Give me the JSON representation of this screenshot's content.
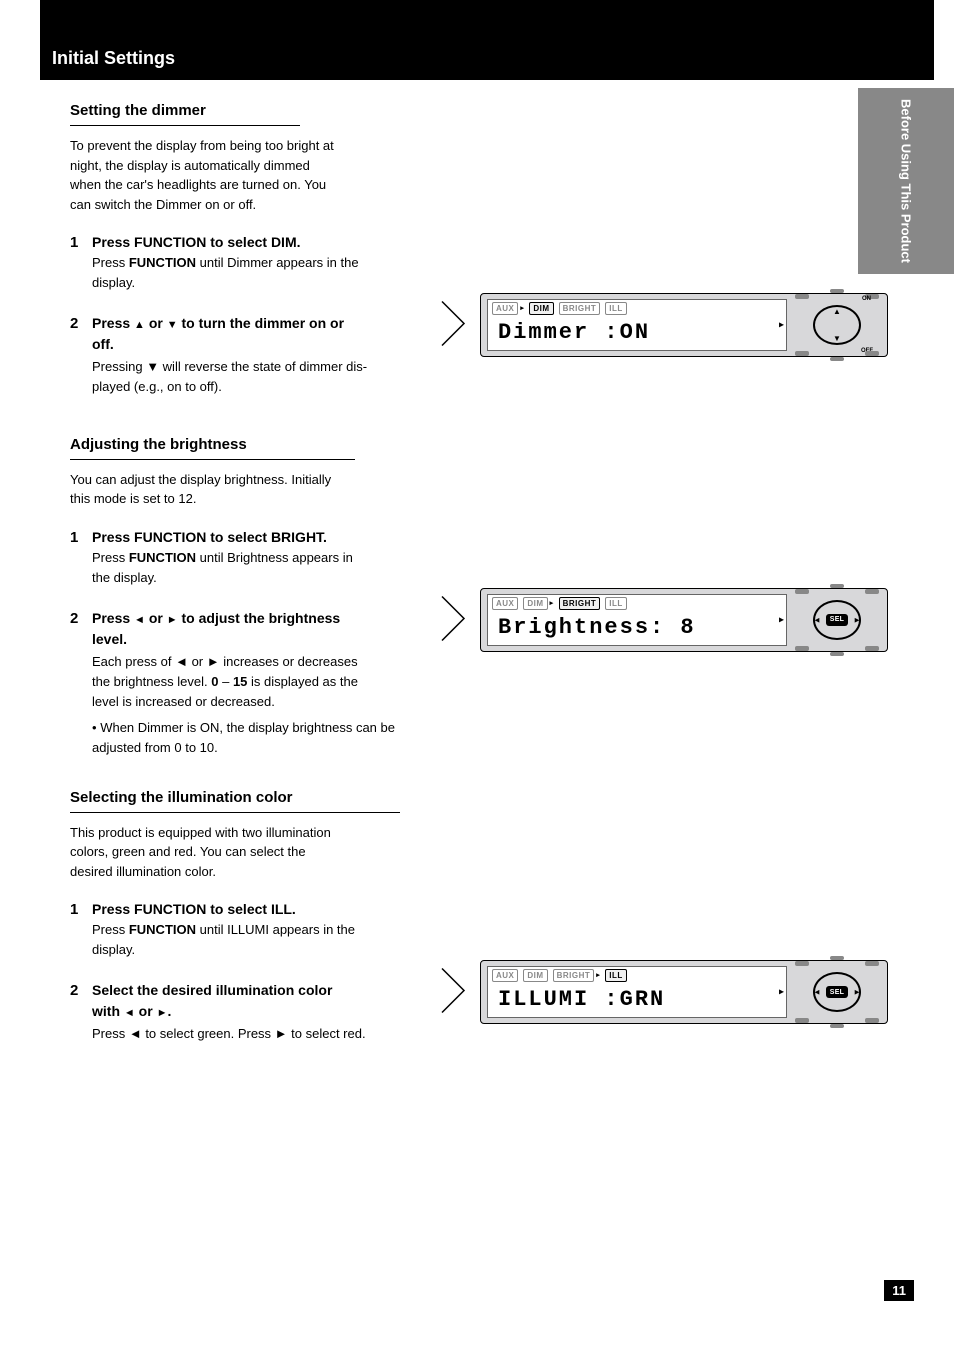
{
  "header_title": "Initial Settings",
  "sidebar_label": "Before Using This Product",
  "sections": {
    "dimmer": {
      "title": "Setting the dimmer",
      "intro_lines": [
        "To prevent the display from being too bright at",
        "night, the display is automatically dimmed",
        "when the car's headlights are turned on. You",
        "can switch the Dimmer on or off."
      ],
      "step1_title": "Press FUNCTION to select DIM.",
      "step1_desc_prefix": "Press ",
      "step1_func": "FUNCTION",
      "step1_desc_mid": " until Dimmer appears in the",
      "step1_desc_end": "display.",
      "step2_prefix": "Press ",
      "step2_arrows_mid": " or ",
      "step2_mid": " to turn the dimmer on or",
      "step2_end": "off.",
      "note_prefix": "Pressing ▼ will reverse the state of dimmer dis-",
      "note_line2": "played (e.g., on to off)."
    },
    "brightness": {
      "title": "Adjusting the brightness",
      "intro_lines": [
        "You can adjust the display brightness. Initially",
        "this mode is set to 12."
      ],
      "step1_title": "Press FUNCTION to select BRIGHT.",
      "step1_desc_prefix": "Press ",
      "step1_func": "FUNCTION",
      "step1_desc_mid": " until Brightness appears in",
      "step1_desc_end": "the display.",
      "step2_prefix": "Press ",
      "step2_arrows_mid": " or ",
      "step2_mid": " to adjust the brightness",
      "step2_end": "level.",
      "note_prefix": "Each press of ◄ or ► increases or decreases",
      "note_line2_a": "the brightness level. ",
      "note_line2_b": "0",
      "note_line2_c": " – ",
      "note_line2_d": "15",
      "note_line2_e": " is displayed as the",
      "note_line3": "level is increased or decreased.",
      "extra_note": "When Dimmer is ON, the display brightness can be adjusted from 0 to 10."
    },
    "illum": {
      "title": "Selecting the illumination color",
      "intro_lines": [
        "This product is equipped with two illumination",
        "colors, green and red. You can select the",
        "desired illumination color."
      ],
      "step1_title": "Press FUNCTION to select ILL.",
      "step1_desc_prefix": "Press ",
      "step1_func": "FUNCTION",
      "step1_desc_mid": " until ILLUMI appears in the",
      "step1_desc_end": "display.",
      "step2_prefix": "Select the desired illumination color",
      "step2_line2_a": "with ",
      "step2_line2_mid": " or ",
      "step2_line2_b": ".",
      "note": "Press ◄ to select green. Press ► to select red."
    }
  },
  "displays": {
    "dimmer": {
      "tabs": [
        "AUX",
        "DIM",
        "BRIGHT",
        "ILL"
      ],
      "active": "DIM",
      "main": "Dimmer  :ON",
      "dpad_mode": "updown",
      "on_label": "ON",
      "off_label": "OFF"
    },
    "brightness": {
      "tabs": [
        "AUX",
        "DIM",
        "BRIGHT",
        "ILL"
      ],
      "active": "BRIGHT",
      "main": "Brightness: 8",
      "dpad_mode": "leftright",
      "center": "SEL"
    },
    "illum": {
      "tabs": [
        "AUX",
        "DIM",
        "BRIGHT",
        "ILL"
      ],
      "active": "ILL",
      "main": "ILLUMI  :GRN",
      "dpad_mode": "leftright",
      "center": "SEL"
    }
  },
  "page": "11",
  "glyphs": {
    "up": "▲",
    "down": "▼",
    "left": "◄",
    "right": "►",
    "sel_indicator": "▸",
    "bullet": "•"
  }
}
